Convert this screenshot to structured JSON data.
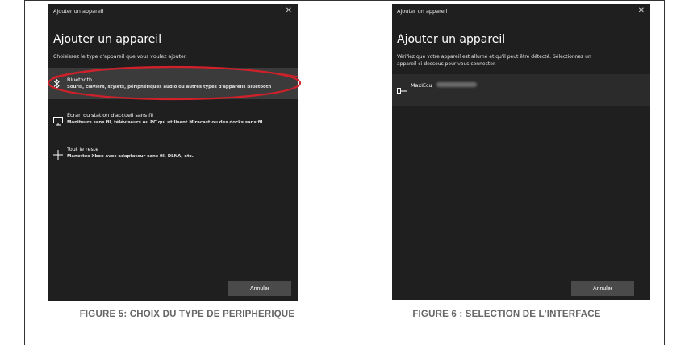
{
  "figure5": {
    "window_title": "Ajouter un appareil",
    "heading": "Ajouter un appareil",
    "subtitle": "Choisissez le type d'appareil que vous voulez ajouter.",
    "options": [
      {
        "icon": "bluetooth-icon",
        "title": "Bluetooth",
        "description": "Souris, claviers, stylets, périphériques audio ou autres types d'appareils Bluetooth",
        "selected": true
      },
      {
        "icon": "monitor-icon",
        "title": "Écran ou station d'accueil sans fil",
        "description": "Moniteurs sans fil, téléviseurs ou PC qui utilisent Miracast ou des docks sans fil",
        "selected": false
      },
      {
        "icon": "plus-icon",
        "title": "Tout le reste",
        "description": "Manettes Xbox avec adaptateur sans fil, DLNA, etc.",
        "selected": false
      }
    ],
    "cancel_label": "Annuler",
    "caption_num": "Figure 5",
    "caption_text": ": Choix du type de peripherique"
  },
  "figure6": {
    "window_title": "Ajouter un appareil",
    "heading": "Ajouter un appareil",
    "subtitle_line1": "Vérifiez que votre appareil est allumé et qu'il peut être détecté. Sélectionnez un",
    "subtitle_line2": "appareil ci-dessous pour vous connecter.",
    "device": {
      "icon": "device-icon",
      "name": "MaxiEcu"
    },
    "cancel_label": "Annuler",
    "caption_num": "Figure 6",
    "caption_text": " : Selection de l'Interface"
  },
  "colors": {
    "dialog_bg": "#1f1f1f",
    "selected_bg": "#3b3b3b",
    "highlight_ellipse": "#d0202a",
    "caption": "#666666"
  }
}
